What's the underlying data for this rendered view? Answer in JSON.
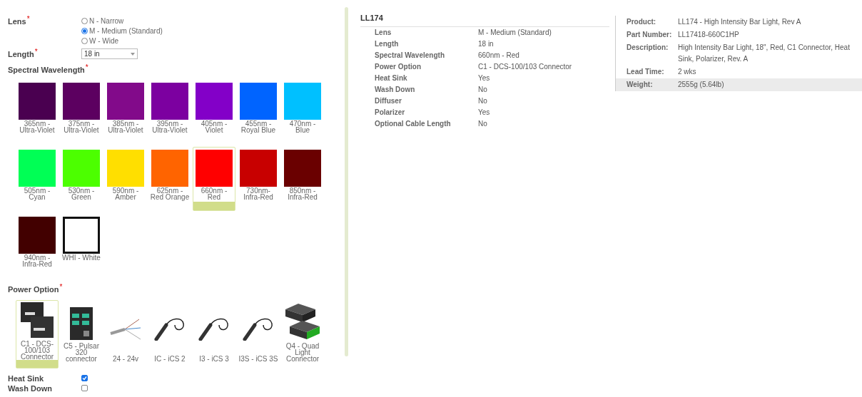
{
  "configurator": {
    "lens": {
      "label": "Lens",
      "required_mark": "*",
      "options": [
        {
          "label": "N - Narrow",
          "selected": false
        },
        {
          "label": "M - Medium (Standard)",
          "selected": true
        },
        {
          "label": "W - Wide",
          "selected": false
        }
      ]
    },
    "length": {
      "label": "Length",
      "required_mark": "*",
      "value": "18 in"
    },
    "wavelength": {
      "label": "Spectral Wavelength",
      "required_mark": "*",
      "options": [
        {
          "lines": [
            "365nm -",
            "Ultra-Violet"
          ],
          "color": "#4a0050",
          "outlined": false,
          "selected": false
        },
        {
          "lines": [
            "375nm -",
            "Ultra-Violet"
          ],
          "color": "#5c0060",
          "outlined": false,
          "selected": false
        },
        {
          "lines": [
            "385nm -",
            "Ultra-Violet"
          ],
          "color": "#820a8a",
          "outlined": false,
          "selected": false
        },
        {
          "lines": [
            "395nm -",
            "Ultra-Violet"
          ],
          "color": "#7c00a0",
          "outlined": false,
          "selected": false
        },
        {
          "lines": [
            "405nm -",
            "Violet"
          ],
          "color": "#8300c8",
          "outlined": false,
          "selected": false
        },
        {
          "lines": [
            "455nm -",
            "Royal Blue"
          ],
          "color": "#0064ff",
          "outlined": false,
          "selected": false
        },
        {
          "lines": [
            "470nm -",
            "Blue"
          ],
          "color": "#00c0ff",
          "outlined": false,
          "selected": false
        },
        {
          "lines": [
            "505nm -",
            "Cyan"
          ],
          "color": "#00ff55",
          "outlined": false,
          "selected": false
        },
        {
          "lines": [
            "530nm -",
            "Green"
          ],
          "color": "#4cff00",
          "outlined": false,
          "selected": false
        },
        {
          "lines": [
            "590nm -",
            "Amber"
          ],
          "color": "#ffdf00",
          "outlined": false,
          "selected": false
        },
        {
          "lines": [
            "625nm -",
            "Red Orange"
          ],
          "color": "#ff6400",
          "outlined": false,
          "selected": false
        },
        {
          "lines": [
            "660nm -",
            "Red"
          ],
          "color": "#ff0000",
          "outlined": false,
          "selected": true
        },
        {
          "lines": [
            "730nm-",
            "Infra-Red"
          ],
          "color": "#c80000",
          "outlined": false,
          "selected": false
        },
        {
          "lines": [
            "850nm -",
            "Infra-Red"
          ],
          "color": "#6a0000",
          "outlined": false,
          "selected": false
        },
        {
          "lines": [
            "940nm -",
            "Infra-Red"
          ],
          "color": "#420000",
          "outlined": false,
          "selected": false
        },
        {
          "lines": [
            "WHI - White"
          ],
          "color": "#ffffff",
          "outlined": true,
          "selected": false
        }
      ]
    },
    "power": {
      "label": "Power Option",
      "required_mark": "*",
      "options": [
        {
          "lines": [
            "C1 - DCS-",
            "100/103",
            "Connector"
          ],
          "kind": "controller",
          "selected": true
        },
        {
          "lines": [
            "C5 - Pulsar",
            "320",
            "connector"
          ],
          "kind": "tower",
          "selected": false
        },
        {
          "lines": [
            "24 - 24v"
          ],
          "kind": "wire",
          "selected": false
        },
        {
          "lines": [
            "IC - iCS 2"
          ],
          "kind": "cable",
          "selected": false
        },
        {
          "lines": [
            "I3 - iCS 3"
          ],
          "kind": "cable",
          "selected": false
        },
        {
          "lines": [
            "I3S - iCS 3S"
          ],
          "kind": "cable",
          "selected": false
        },
        {
          "lines": [
            "Q4 - Quad",
            "Light",
            "Connector"
          ],
          "kind": "boxes",
          "selected": false
        }
      ]
    },
    "checkboxes": [
      {
        "label": "Heat Sink",
        "checked": true
      },
      {
        "label": "Wash Down",
        "checked": false
      }
    ]
  },
  "summary": {
    "title": "LL174",
    "rows": [
      {
        "label": "Lens",
        "value": "M - Medium (Standard)"
      },
      {
        "label": "Length",
        "value": "18 in"
      },
      {
        "label": "Spectral Wavelength",
        "value": "660nm - Red"
      },
      {
        "label": "Power Option",
        "value": "C1 - DCS-100/103 Connector"
      },
      {
        "label": "Heat Sink",
        "value": "Yes"
      },
      {
        "label": "Wash Down",
        "value": "No"
      },
      {
        "label": "Diffuser",
        "value": "No"
      },
      {
        "label": "Polarizer",
        "value": "Yes"
      },
      {
        "label": "Optional Cable Length",
        "value": "No"
      }
    ]
  },
  "product_info": [
    {
      "label": "Product:",
      "value": "LL174 - High Intensity Bar Light, Rev A",
      "highlighted": false
    },
    {
      "label": "Part Number:",
      "value": "LL17418-660C1HP",
      "highlighted": false
    },
    {
      "label": "Description:",
      "value": "High Intensity Bar Light, 18\", Red, C1 Connector, Heat Sink, Polarizer, Rev. A",
      "highlighted": false
    },
    {
      "label": "Lead Time:",
      "value": "2 wks",
      "highlighted": false
    },
    {
      "label": "Weight:",
      "value": "2555g (5.64lb)",
      "highlighted": true
    }
  ]
}
